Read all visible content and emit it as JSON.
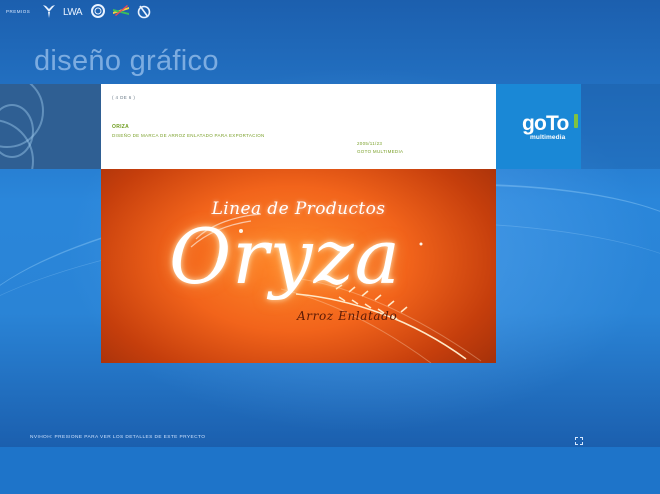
{
  "header": {
    "prizes_label": "PREMIOS",
    "awards": [
      {
        "name": "award-bird-icon"
      },
      {
        "name": "award-lwa-logo",
        "text": "LWA"
      },
      {
        "name": "award-ring-icon"
      },
      {
        "name": "award-color-bars-icon"
      },
      {
        "name": "award-swirl-icon"
      }
    ]
  },
  "section": {
    "title": "diseño gráfico"
  },
  "project": {
    "counter": "( 4 DE 6 )",
    "title": "ORIZA",
    "description": "DISEÑO DE MARCA DE ARROZ ENLATADO PARA EXPORTACION",
    "date": "2005/11/23",
    "client": "GOTO MULTIMEDIA"
  },
  "client_logo": {
    "word": "goTo",
    "sub": "multimedia"
  },
  "artwork": {
    "line": "Linea de Productos",
    "brand": "Oryza",
    "tagline": "Arroz Enlatado"
  },
  "footer": {
    "hint": "NVIHOH: PRESIONE PARA VER LOS DETALLES DE ESTE PRYECTO"
  },
  "colors": {
    "accent_green": "#7aa02a",
    "logo_blue": "#1a88d6",
    "artwork_orange": "#f2641b"
  }
}
